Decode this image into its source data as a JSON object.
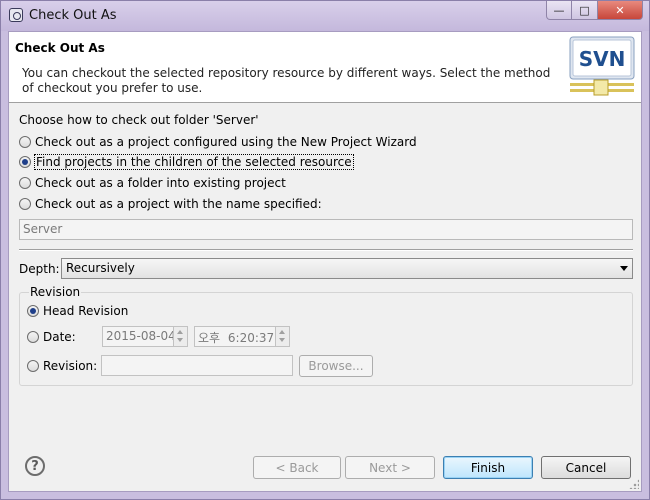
{
  "window": {
    "title": "Check Out As",
    "controls": {
      "minimize": "—",
      "maximize": "□",
      "close": "✕"
    }
  },
  "banner": {
    "title": "Check Out As",
    "description": "You can checkout the selected repository resource by different ways. Select the method of checkout you prefer to use.",
    "logo_text": "SVN"
  },
  "checkout": {
    "prompt": "Choose how to check out folder 'Server'",
    "options": [
      {
        "label": "Check out as a project configured using the New Project Wizard",
        "selected": false
      },
      {
        "label": "Find projects in the children of the selected resource",
        "selected": true
      },
      {
        "label": "Check out as a folder into existing project",
        "selected": false
      },
      {
        "label": "Check out as a project with the name specified:",
        "selected": false
      }
    ],
    "project_name": "Server"
  },
  "depth": {
    "label": "Depth:",
    "value": "Recursively"
  },
  "revision": {
    "group_title": "Revision",
    "head_label": "Head Revision",
    "head_selected": true,
    "date_label": "Date:",
    "date_value": "2015-08-04",
    "time_value": "오후 6:20:37",
    "revision_label": "Revision:",
    "revision_value": "",
    "browse_label": "Browse..."
  },
  "buttons": {
    "back": "< Back",
    "next": "Next >",
    "finish": "Finish",
    "cancel": "Cancel"
  },
  "colors": {
    "frame": "#c9bedf",
    "dialog_bg": "#f0f0f0",
    "svn_blue": "#1f4f8f",
    "svn_gold": "#d9c25a"
  }
}
